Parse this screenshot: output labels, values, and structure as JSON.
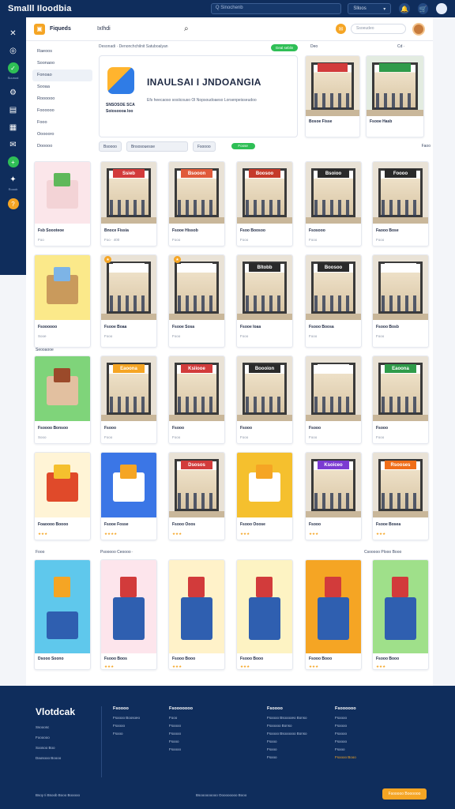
{
  "app": {
    "title": "Smalll Iloodbia"
  },
  "topbar": {
    "search_placeholder": "Q Sinochenb",
    "pill_label": "Slloos",
    "icons": [
      "bell-icon",
      "cart-icon",
      "user-icon"
    ]
  },
  "rail": {
    "labels": [
      "Suuroal",
      "Rooob"
    ]
  },
  "panel": {
    "title": "Fiqueds",
    "tab_label": "IxIhdi",
    "search_input_placeholder": "Ssoeudeo",
    "crumb": "Desonadi · Denonchchilnit Satuboalyan",
    "green_badge": "Geal seblin",
    "featured_label": "Deo",
    "featured_label2": "Cd ·"
  },
  "sidenav": {
    "items": [
      "Raeoos",
      "Soonaoo",
      "Fonoao",
      "Sooaa",
      "Roooooo",
      "Foooooo",
      "Fooo",
      "Oooooro",
      "Dooooo"
    ],
    "active_index": 2
  },
  "banner": {
    "title": "INAULSAI I JNDOANGIA",
    "subtitle": "Efs heecaoso sosiicouso Ol Nopsoudoaeso Lorsenpeisseudoo",
    "tag": "SNSOSOE SCA Soiosoooa loo"
  },
  "featured": [
    {
      "title": "Bosoe Fisse",
      "color": "#d23b3b"
    },
    {
      "title": "Fsooe Hasb",
      "color": "#2f9b4a"
    }
  ],
  "filters": {
    "chips": [
      "Bsoooo",
      "Bnsosouesse",
      "Fsoooo"
    ],
    "toggle": "Foose",
    "right_label": "Faoo"
  },
  "grid": {
    "sidebar_cards": [
      {
        "title": "Fsb Soooteoe",
        "meta": "Foo"
      },
      {
        "title": "Fsoooooo",
        "meta": "Sooe"
      },
      {
        "title": "Fsoooo Bonsoo",
        "meta": "Sooo"
      },
      {
        "title": "Foaoooo Boooo",
        "meta": "★★★"
      },
      {
        "title": "Dsooo Soono",
        "meta": "Fooo"
      }
    ],
    "rows": [
      [
        {
          "title": "Bnoce Fissia",
          "meta": "Foo · 400",
          "sign": "Ssieb",
          "color": "#d23b3b"
        },
        {
          "title": "Fsooe Hissob",
          "meta": "Fooo",
          "sign": "Bsooon",
          "color": "#e05a3a"
        },
        {
          "title": "Fsoo Boosoo",
          "meta": "Fooo",
          "sign": "Boosoo",
          "color": "#c53a2a"
        },
        {
          "title": "Fsosooo",
          "meta": "Fooo",
          "sign": "Bsoioo",
          "color": "#2a2a2a"
        },
        {
          "title": "Faooo Bose",
          "meta": "Fooo",
          "sign": "Foooo",
          "color": "#2a2a2a"
        }
      ],
      [
        {
          "title": "Fsooe Boaa",
          "meta": "Fooo",
          "sign": "",
          "color": "#ffffff"
        },
        {
          "title": "Fsooe Sosa",
          "meta": "Fooo",
          "sign": "",
          "color": "#ffffff"
        },
        {
          "title": "Fsooe Ioaa",
          "meta": "Fooo",
          "sign": "Bltobb",
          "color": "#2a2a2a"
        },
        {
          "title": "Fsooo Boosa",
          "meta": "Fooo",
          "sign": "Boosoo",
          "color": "#2a2a2a"
        },
        {
          "title": "Fsooo Bosb",
          "meta": "Fooo",
          "sign": "",
          "color": "#ffffff"
        }
      ],
      [
        {
          "title": "Fsooo",
          "meta": "Fooo",
          "sign": "Eaoona",
          "color": "#f5a524"
        },
        {
          "title": "Fsooo",
          "meta": "Fooo",
          "sign": "Ksiiooe",
          "color": "#d23b3b"
        },
        {
          "title": "Fsooo",
          "meta": "Fooo",
          "sign": "Boooion",
          "color": "#2a2a2a"
        },
        {
          "title": "Fsooo",
          "meta": "Fooo",
          "sign": "",
          "color": "#ffffff"
        },
        {
          "title": "Fsooo",
          "meta": "Fooo",
          "sign": "Eaoona",
          "color": "#2f9b4a"
        }
      ],
      [
        {
          "title": "Fsooe Fosse",
          "meta": "★★★★",
          "toy": true,
          "color": "#3b76e6"
        },
        {
          "title": "Fsooo Ooos",
          "meta": "★★★",
          "sign": "Dsosos",
          "color": "#d23b3b"
        },
        {
          "title": "Fsooo Ooose",
          "meta": "★★★",
          "toy": true,
          "color": "#f5c02e"
        },
        {
          "title": "Fsooo",
          "meta": "★★★",
          "sign": "Ksoiceo",
          "color": "#7b3bd2"
        },
        {
          "title": "Fsooe Bosea",
          "meta": "★★★",
          "sign": "Rsooses",
          "color": "#f06e1a"
        }
      ]
    ],
    "section_label_left": "Seooaooe",
    "section_label_mid": "Psooooo Ceoooo ·",
    "section_label_right": "Csooooo Plooo Booo",
    "bottom_row": [
      {
        "title": "Fsooo Boos",
        "meta": "★★★"
      },
      {
        "title": "Fsooo Booo",
        "meta": "★★★"
      },
      {
        "title": "Fsooo Booo",
        "meta": "★★★"
      },
      {
        "title": "Fsooo Booo",
        "meta": "★★★"
      },
      {
        "title": "Fsooo Booo",
        "meta": "★★★"
      }
    ]
  },
  "footer": {
    "brand": "Vlotdcak",
    "left_links": [
      "Ssooosc",
      "Foooooo",
      "Soosoo Boo",
      "Daosooo Boooo"
    ],
    "columns": [
      {
        "heading": "Fsoooo",
        "links": [
          "Fsoooo Boosoeo",
          "Fsoooo",
          "Fsooo"
        ]
      },
      {
        "heading": "Fsooooooo",
        "links": [
          "Fooo",
          "Fsoooo",
          "Fsoooo",
          "Fsooo",
          "Fsoooo"
        ]
      },
      {
        "heading": "Fsoooo",
        "links": [
          "Fsoooo Bsooooeo Bonso",
          "Fsooooo Bonso",
          "Fsoooo Bsoooooo Bonso",
          "Fsooo",
          "Fsooo",
          "Fsooo"
        ]
      },
      {
        "heading": "Fsoooooo",
        "links": [
          "Fsoooo",
          "Fsoooo",
          "Fsoooo",
          "Fsoooo",
          "Fsooo",
          "Fsoooo Booo"
        ]
      }
    ],
    "bottom_left": "Bsoy Ii   Bsoob Booo Booooo",
    "bottom_mid": "Bsooooooooo Ooooooooo Booo",
    "cta": "Fsooooo Boooooo"
  },
  "colors": {
    "navy": "#0f2d5c",
    "accent": "#f5a524",
    "success": "#2fbf56"
  }
}
